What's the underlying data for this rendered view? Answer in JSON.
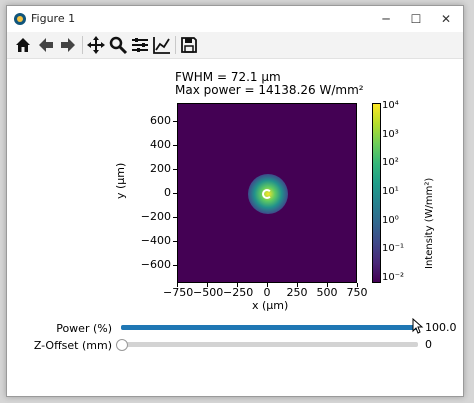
{
  "window": {
    "title": "Figure 1",
    "minimize_glyph": "─",
    "maximize_glyph": "☐",
    "close_glyph": "✕"
  },
  "toolbar": {
    "icons": [
      "home-icon",
      "back-arrow-icon",
      "forward-arrow-icon",
      "pan-icon",
      "zoom-icon",
      "configure-subplots-icon",
      "edit-axis-icon",
      "save-icon"
    ]
  },
  "plot": {
    "title_line1": "FWHM = 72.1 µm",
    "title_line2": "Max power = 14138.26 W/mm²",
    "xlabel": "x (µm)",
    "ylabel": "y (µm)",
    "xticks": [
      "−750",
      "−500",
      "−250",
      "0",
      "250",
      "500",
      "750"
    ],
    "yticks": [
      "600",
      "400",
      "200",
      "0",
      "−200",
      "−400",
      "−600"
    ],
    "colorbar_label": "Intensity (W/mm²)",
    "colorbar_ticks": [
      "10⁴",
      "10³",
      "10²",
      "10¹",
      "10⁰",
      "10⁻¹",
      "10⁻²"
    ],
    "colormap": "viridis"
  },
  "chart_data": {
    "type": "heatmap",
    "title": "FWHM = 72.1 µm\nMax power = 14138.26 W/mm²",
    "xlabel": "x (µm)",
    "ylabel": "y (µm)",
    "xlim": [
      -750,
      750
    ],
    "ylim": [
      -750,
      750
    ],
    "colorbar": {
      "label": "Intensity (W/mm²)",
      "scale": "log",
      "range": [
        0.01,
        14138.26
      ]
    },
    "beam_center": [
      0,
      0
    ],
    "fwhm_um": 72.1,
    "max_power": 14138.26
  },
  "sliders": [
    {
      "label": "Power (%)",
      "value": "100.0",
      "fraction": 1.0,
      "color": "#1f77b4"
    },
    {
      "label": "Z-Offset (mm)",
      "value": "0",
      "fraction": 0.0,
      "color": "#1f77b4"
    }
  ]
}
